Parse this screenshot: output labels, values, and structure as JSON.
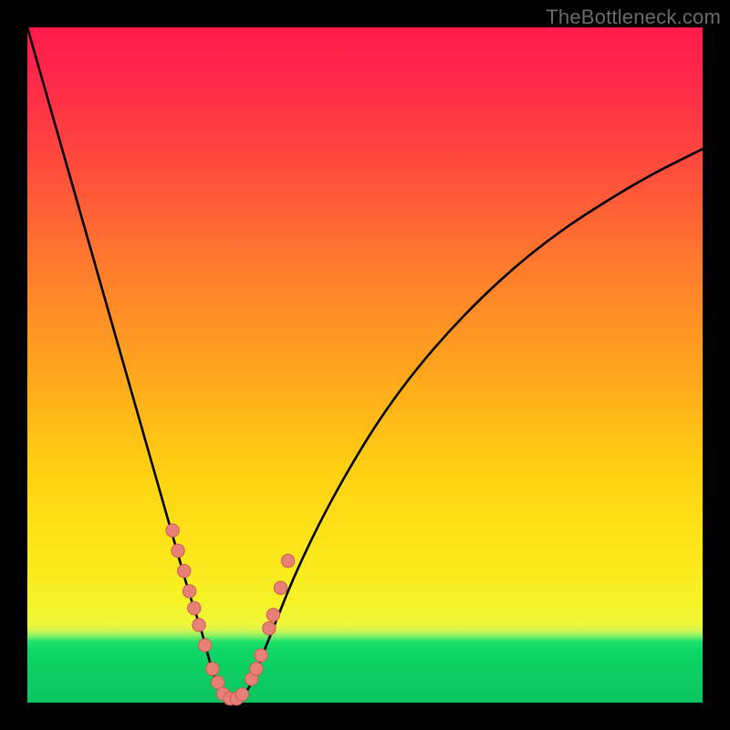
{
  "watermark": "TheBottleneck.com",
  "colors": {
    "frame": "#000000",
    "curve": "#000000",
    "marker_fill": "#e98077",
    "marker_stroke": "#c85d54",
    "good_band": "#0bc560",
    "gradient_top": "#ff1a4b",
    "gradient_mid": "#ffcf12"
  },
  "chart_data": {
    "type": "line",
    "title": "",
    "xlabel": "",
    "ylabel": "",
    "xlim": [
      0,
      100
    ],
    "ylim": [
      0,
      100
    ],
    "note": "y is bottleneck percentage; 0 at bottom (green) up to 100 at top (red). x is an implicit component-performance axis. Curve is a V-shaped bottleneck curve with minimum near x≈30.",
    "series": [
      {
        "name": "bottleneck-curve",
        "x": [
          0,
          4,
          8,
          12,
          16,
          20,
          22,
          24,
          26,
          27,
          28,
          29,
          30,
          31,
          32,
          33,
          34,
          36,
          40,
          46,
          54,
          64,
          76,
          90,
          100
        ],
        "values": [
          100,
          86,
          72,
          58,
          44,
          30,
          23,
          16,
          10,
          6,
          3,
          1,
          0.5,
          0.5,
          1,
          2.5,
          5,
          10,
          20,
          32,
          45,
          57,
          68,
          77,
          82
        ]
      }
    ],
    "markers": {
      "name": "sample-points",
      "x": [
        21.5,
        22.3,
        23.2,
        24.0,
        24.7,
        25.4,
        26.3,
        27.4,
        28.2,
        29.0,
        30.0,
        31.0,
        31.8,
        33.2,
        33.9,
        34.6,
        35.8,
        36.4,
        37.5,
        38.6
      ],
      "values": [
        25.5,
        22.5,
        19.5,
        16.5,
        14.0,
        11.5,
        8.5,
        5.0,
        3.0,
        1.3,
        0.6,
        0.6,
        1.2,
        3.5,
        5.0,
        7.0,
        11.0,
        13.0,
        17.0,
        21.0
      ]
    }
  }
}
